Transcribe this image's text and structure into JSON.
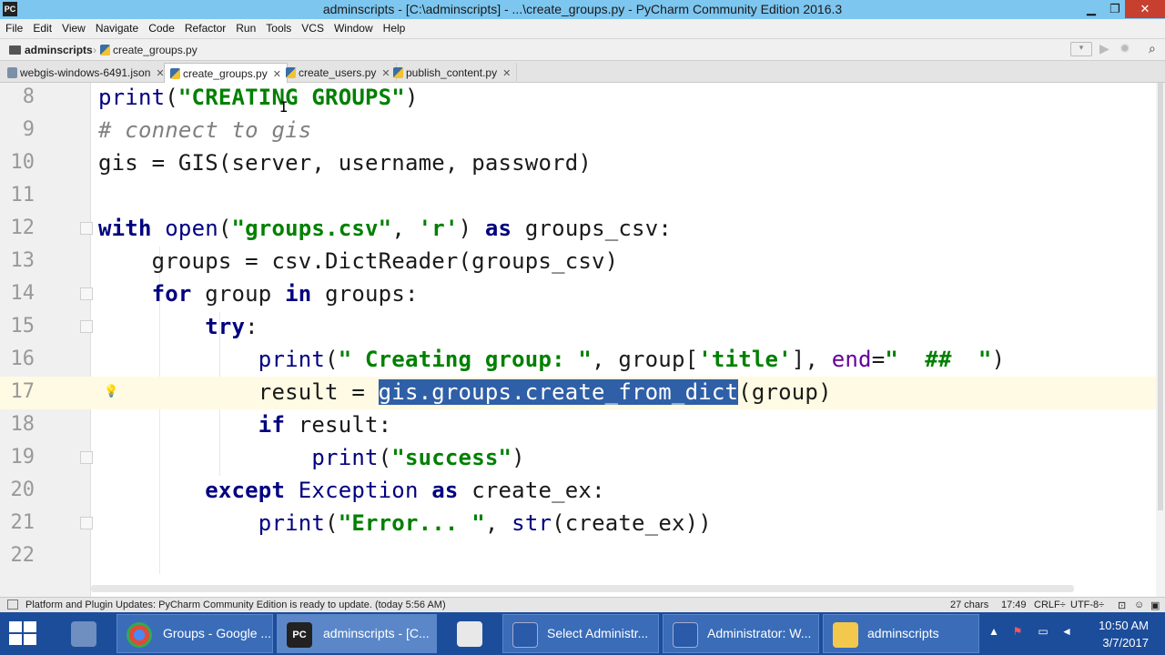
{
  "window": {
    "title": "adminscripts - [C:\\adminscripts] - ...\\create_groups.py - PyCharm Community Edition 2016.3",
    "app_icon": "PC"
  },
  "menu": [
    "File",
    "Edit",
    "View",
    "Navigate",
    "Code",
    "Refactor",
    "Run",
    "Tools",
    "VCS",
    "Window",
    "Help"
  ],
  "breadcrumb": {
    "project": "adminscripts",
    "file": "create_groups.py"
  },
  "tabs": [
    {
      "label": "webgis-windows-6491.json",
      "icon": "json-file-icon",
      "active": false
    },
    {
      "label": "create_groups.py",
      "icon": "python-file-icon",
      "active": true
    },
    {
      "label": "create_users.py",
      "icon": "python-file-icon",
      "active": false
    },
    {
      "label": "publish_content.py",
      "icon": "python-file-icon",
      "active": false
    }
  ],
  "editor": {
    "line_numbers": [
      "8",
      "9",
      "10",
      "11",
      "12",
      "13",
      "14",
      "15",
      "16",
      "17",
      "18",
      "19",
      "20",
      "21",
      "22"
    ],
    "lines": {
      "l8": [
        "print",
        "(",
        "\"CREATING GROUPS\"",
        ")"
      ],
      "l9": "# connect to gis",
      "l10": [
        "gis = ",
        "GIS",
        "(server, username, password)"
      ],
      "l11": "",
      "l12": [
        "with",
        " ",
        "open",
        "(",
        "\"groups.csv\"",
        ", ",
        "'r'",
        ") ",
        "as",
        " groups_csv:"
      ],
      "l13": [
        "    groups = csv.DictReader(groups_csv)"
      ],
      "l14": [
        "    ",
        "for",
        " group ",
        "in",
        " groups:"
      ],
      "l15": [
        "        ",
        "try",
        ":"
      ],
      "l16": [
        "            ",
        "print",
        "(",
        "\" Creating group: \"",
        ", group[",
        "'title'",
        "], ",
        "end",
        "=",
        "\"  ##  \"",
        ")"
      ],
      "l17": [
        "            result = ",
        "gis.groups.create_from_dict",
        "(group)"
      ],
      "l18": [
        "            ",
        "if",
        " result:"
      ],
      "l19": [
        "                ",
        "print",
        "(",
        "\"success\"",
        ")"
      ],
      "l20": [
        "        ",
        "except",
        " ",
        "Exception",
        " ",
        "as",
        " create_ex:"
      ],
      "l21": [
        "            ",
        "print",
        "(",
        "\"Error... \"",
        ", ",
        "str",
        "(create_ex))"
      ],
      "l22": ""
    },
    "current_line": "17",
    "selected_text": "gis.groups.create_from_dict"
  },
  "status": {
    "message": "Platform and Plugin Updates: PyCharm Community Edition is ready to update. (today 5:56 AM)",
    "chars": "27 chars",
    "position": "17:49",
    "line_sep": "CRLF÷",
    "encoding": "UTF-8÷"
  },
  "taskbar": {
    "items": [
      {
        "label": "Groups - Google ...",
        "icon": "chrome-icon"
      },
      {
        "label": "adminscripts - [C...",
        "icon": "pycharm-icon"
      },
      {
        "label": "Select Administr...",
        "icon": "powershell-icon"
      },
      {
        "label": "Administrator: W...",
        "icon": "powershell-icon"
      },
      {
        "label": "adminscripts",
        "icon": "folder-icon"
      }
    ],
    "time": "10:50 AM",
    "date": "3/7/2017"
  },
  "colors": {
    "keyword": "#000080",
    "string": "#008000",
    "comment": "#808080",
    "selection": "#2f5fa7",
    "current_line": "#fffae3",
    "titlebar": "#7dc6ef",
    "taskbar": "#1c4d9a"
  }
}
